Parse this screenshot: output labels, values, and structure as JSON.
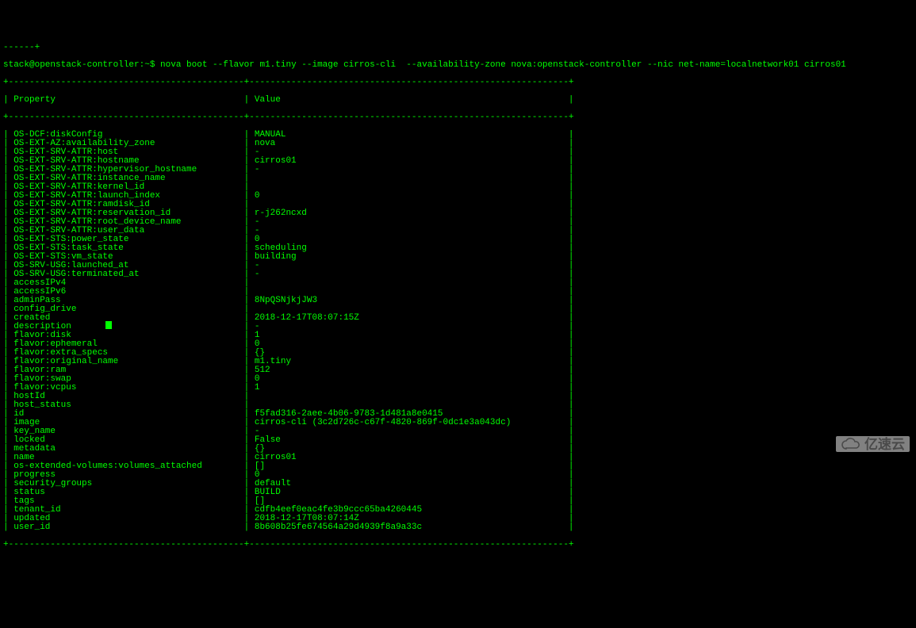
{
  "prompt_dashes": "------+",
  "prompt": "stack@openstack-controller:~$ ",
  "command": "nova boot --flavor m1.tiny --image cirros-cli  --availability-zone nova:openstack-controller --nic net-name=localnetwork01 cirros01",
  "table": {
    "header": [
      "Property",
      "Value"
    ],
    "border_top": "+---------------------------------------------+-------------------------------------------------------------+",
    "border_header": "+---------------------------------------------+-------------------------------------------------------------+",
    "border_bottom": "+---------------------------------------------+-------------------------------------------------------------+",
    "rows": [
      [
        "OS-DCF:diskConfig",
        "MANUAL"
      ],
      [
        "OS-EXT-AZ:availability_zone",
        "nova"
      ],
      [
        "OS-EXT-SRV-ATTR:host",
        "-"
      ],
      [
        "OS-EXT-SRV-ATTR:hostname",
        "cirros01"
      ],
      [
        "OS-EXT-SRV-ATTR:hypervisor_hostname",
        "-"
      ],
      [
        "OS-EXT-SRV-ATTR:instance_name",
        ""
      ],
      [
        "OS-EXT-SRV-ATTR:kernel_id",
        ""
      ],
      [
        "OS-EXT-SRV-ATTR:launch_index",
        "0"
      ],
      [
        "OS-EXT-SRV-ATTR:ramdisk_id",
        ""
      ],
      [
        "OS-EXT-SRV-ATTR:reservation_id",
        "r-j262ncxd"
      ],
      [
        "OS-EXT-SRV-ATTR:root_device_name",
        "-"
      ],
      [
        "OS-EXT-SRV-ATTR:user_data",
        "-"
      ],
      [
        "OS-EXT-STS:power_state",
        "0"
      ],
      [
        "OS-EXT-STS:task_state",
        "scheduling"
      ],
      [
        "OS-EXT-STS:vm_state",
        "building"
      ],
      [
        "OS-SRV-USG:launched_at",
        "-"
      ],
      [
        "OS-SRV-USG:terminated_at",
        "-"
      ],
      [
        "accessIPv4",
        ""
      ],
      [
        "accessIPv6",
        ""
      ],
      [
        "adminPass",
        "8NpQSNjkjJW3"
      ],
      [
        "config_drive",
        ""
      ],
      [
        "created",
        "2018-12-17T08:07:15Z"
      ],
      [
        "description",
        "-"
      ],
      [
        "flavor:disk",
        "1"
      ],
      [
        "flavor:ephemeral",
        "0"
      ],
      [
        "flavor:extra_specs",
        "{}"
      ],
      [
        "flavor:original_name",
        "m1.tiny"
      ],
      [
        "flavor:ram",
        "512"
      ],
      [
        "flavor:swap",
        "0"
      ],
      [
        "flavor:vcpus",
        "1"
      ],
      [
        "hostId",
        ""
      ],
      [
        "host_status",
        ""
      ],
      [
        "id",
        "f5fad316-2aee-4b06-9783-1d481a8e0415"
      ],
      [
        "image",
        "cirros-cli (3c2d726c-c67f-4820-869f-0dc1e3a043dc)"
      ],
      [
        "key_name",
        "-"
      ],
      [
        "locked",
        "False"
      ],
      [
        "metadata",
        "{}"
      ],
      [
        "name",
        "cirros01"
      ],
      [
        "os-extended-volumes:volumes_attached",
        "[]"
      ],
      [
        "progress",
        "0"
      ],
      [
        "security_groups",
        "default"
      ],
      [
        "status",
        "BUILD"
      ],
      [
        "tags",
        "[]"
      ],
      [
        "tenant_id",
        "cdfb4eef0eac4fe3b9ccc65ba4260445"
      ],
      [
        "updated",
        "2018-12-17T08:07:14Z"
      ],
      [
        "user_id",
        "8b608b25fe674564a29d4939f8a9a33c"
      ]
    ],
    "col1_width": 43,
    "col2_width": 59
  },
  "watermark": "亿速云"
}
